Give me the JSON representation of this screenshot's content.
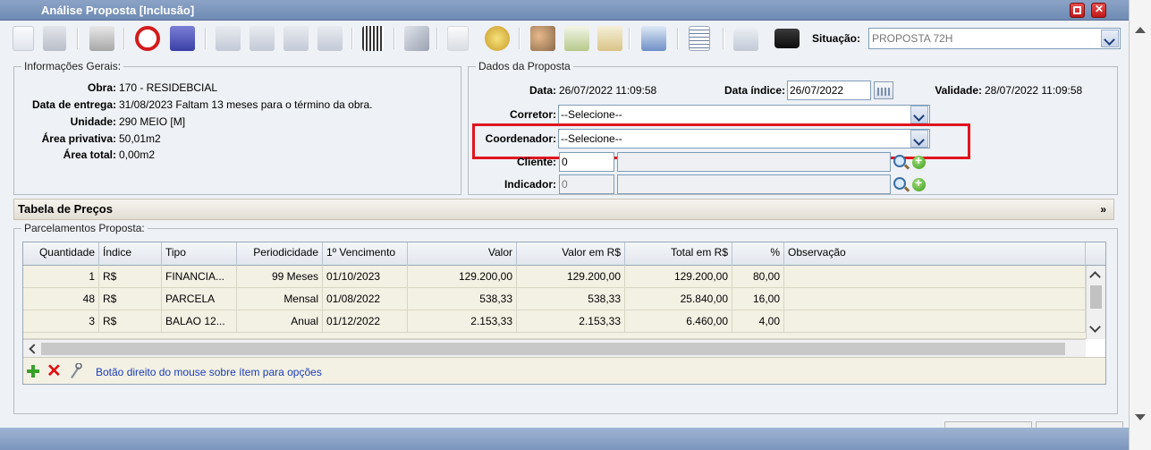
{
  "window": {
    "title": "Análise Proposta [Inclusão]"
  },
  "toolbar": {
    "icons": [
      "new-document-icon",
      "trash-icon",
      "print-icon",
      "cancel-icon",
      "save-icon",
      "first-icon",
      "previous-icon",
      "next-icon",
      "last-icon",
      "barcode-icon",
      "tools-icon",
      "delete-doc-icon",
      "magic-icon",
      "users-icon",
      "copy-icon",
      "edit-icon",
      "calculator-icon",
      "report-icon",
      "stamp-icon",
      "camera-icon"
    ],
    "situacao_label": "Situação:",
    "situacao_value": "PROPOSTA 72H"
  },
  "informacoes_gerais": {
    "legend": "Informações Gerais:",
    "fields": [
      {
        "label": "Obra:",
        "value": "170 - RESIDEBCIAL"
      },
      {
        "label": "Data de entrega:",
        "value": "31/08/2023 Faltam 13 meses para o término da obra."
      },
      {
        "label": "Unidade:",
        "value": "290 MEIO [M]"
      },
      {
        "label": "Área privativa:",
        "value": "50,01m2"
      },
      {
        "label": "Área total:",
        "value": "0,00m2"
      }
    ]
  },
  "dados_proposta": {
    "legend": "Dados da Proposta",
    "data_label": "Data:",
    "data_value": "26/07/2022 11:09:58",
    "data_indice_label": "Data índice:",
    "data_indice_value": "26/07/2022",
    "validade_label": "Validade:",
    "validade_value": "28/07/2022 11:09:58",
    "corretor_label": "Corretor:",
    "corretor_value": "--Selecione--",
    "coordenador_label": "Coordenador:",
    "coordenador_value": "--Selecione--",
    "cliente_label": "Cliente:",
    "cliente_value": "0",
    "indicador_label": "Indicador:",
    "indicador_value": "0"
  },
  "tabela_precos": {
    "label": "Tabela de Preços",
    "toggle": "»"
  },
  "parcelamentos": {
    "legend": "Parcelamentos Proposta:",
    "columns": [
      "Quantidade",
      "Índice",
      "Tipo",
      "Periodicidade",
      "1º Vencimento",
      "Valor",
      "Valor em R$",
      "Total em R$",
      "%",
      "Observação"
    ],
    "rows": [
      [
        "1",
        "R$",
        "FINANCIA...",
        "99 Meses",
        "01/10/2023",
        "129.200,00",
        "129.200,00",
        "129.200,00",
        "80,00",
        ""
      ],
      [
        "48",
        "R$",
        "PARCELA",
        "Mensal",
        "01/08/2022",
        "538,33",
        "538,33",
        "25.840,00",
        "16,00",
        ""
      ],
      [
        "3",
        "R$",
        "BALAO 12...",
        "Anual",
        "01/12/2022",
        "2.153,33",
        "2.153,33",
        "6.460,00",
        "4,00",
        ""
      ]
    ],
    "hint": "Botão direito do mouse sobre ítem para opções"
  },
  "colors": {
    "title_bar": "#7b95bd",
    "highlight": "#e0141e",
    "row_bg": "#f3f1e4",
    "hint_text": "#1a3cb8"
  }
}
